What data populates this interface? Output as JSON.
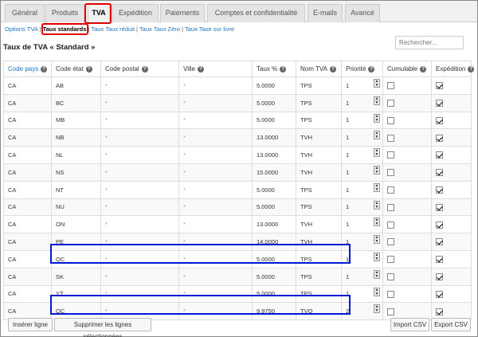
{
  "tabs": [
    "Général",
    "Produits",
    "TVA",
    "Expédition",
    "Paiements",
    "Comptes et confidentialité",
    "E-mails",
    "Avancé"
  ],
  "active_tab_index": 2,
  "subnav": {
    "options": "Options TVA",
    "standard": "Taux standards",
    "reduit": "Taux Taux réduit",
    "zero": "Taux Taux Zéro",
    "livre": "Taux Taxe sur livre"
  },
  "search": {
    "placeholder": "Rechercher..."
  },
  "section_title": "Taux de TVA « Standard »",
  "columns": [
    "Code pays",
    "Code état",
    "Code postal",
    "Ville",
    "Taux %",
    "Nom TVA",
    "Priorité",
    "Cumulable",
    "Expédition"
  ],
  "rows": [
    {
      "country": "CA",
      "state": "AB",
      "postcode": "*",
      "city": "*",
      "rate": "5.0000",
      "name": "TPS",
      "priority": "1",
      "compound": false,
      "shipping": true
    },
    {
      "country": "CA",
      "state": "BC",
      "postcode": "*",
      "city": "*",
      "rate": "5.0000",
      "name": "TPS",
      "priority": "1",
      "compound": false,
      "shipping": true
    },
    {
      "country": "CA",
      "state": "MB",
      "postcode": "*",
      "city": "*",
      "rate": "5.0000",
      "name": "TPS",
      "priority": "1",
      "compound": false,
      "shipping": true
    },
    {
      "country": "CA",
      "state": "NB",
      "postcode": "*",
      "city": "*",
      "rate": "13.0000",
      "name": "TVH",
      "priority": "1",
      "compound": false,
      "shipping": true
    },
    {
      "country": "CA",
      "state": "NL",
      "postcode": "*",
      "city": "*",
      "rate": "13.0000",
      "name": "TVH",
      "priority": "1",
      "compound": false,
      "shipping": true
    },
    {
      "country": "CA",
      "state": "NS",
      "postcode": "*",
      "city": "*",
      "rate": "15.0000",
      "name": "TVH",
      "priority": "1",
      "compound": false,
      "shipping": true
    },
    {
      "country": "CA",
      "state": "NT",
      "postcode": "*",
      "city": "*",
      "rate": "5.0000",
      "name": "TPS",
      "priority": "1",
      "compound": false,
      "shipping": true
    },
    {
      "country": "CA",
      "state": "NU",
      "postcode": "*",
      "city": "*",
      "rate": "5.0000",
      "name": "TPS",
      "priority": "1",
      "compound": false,
      "shipping": true
    },
    {
      "country": "CA",
      "state": "ON",
      "postcode": "*",
      "city": "*",
      "rate": "13.0000",
      "name": "TVH",
      "priority": "1",
      "compound": false,
      "shipping": true
    },
    {
      "country": "CA",
      "state": "PE",
      "postcode": "*",
      "city": "*",
      "rate": "14.0000",
      "name": "TVH",
      "priority": "1",
      "compound": false,
      "shipping": true
    },
    {
      "country": "CA",
      "state": "QC",
      "postcode": "*",
      "city": "*",
      "rate": "5.0000",
      "name": "TPS",
      "priority": "1",
      "compound": false,
      "shipping": true
    },
    {
      "country": "CA",
      "state": "SK",
      "postcode": "*",
      "city": "*",
      "rate": "5.0000",
      "name": "TPS",
      "priority": "1",
      "compound": false,
      "shipping": true
    },
    {
      "country": "CA",
      "state": "YT",
      "postcode": "*",
      "city": "*",
      "rate": "5.0000",
      "name": "TPS",
      "priority": "1",
      "compound": false,
      "shipping": true
    },
    {
      "country": "CA",
      "state": "QC",
      "postcode": "*",
      "city": "*",
      "rate": "9.9750",
      "name": "TVQ",
      "priority": "2",
      "compound": false,
      "shipping": true
    }
  ],
  "buttons": {
    "insert": "Insérer ligne",
    "delete": "Supprimer les lignes sélectionnées",
    "import": "Import CSV",
    "export": "Export CSV"
  },
  "colors": {
    "highlight_red": "#e00000",
    "highlight_blue": "#0018d8",
    "link": "#1e73be"
  }
}
